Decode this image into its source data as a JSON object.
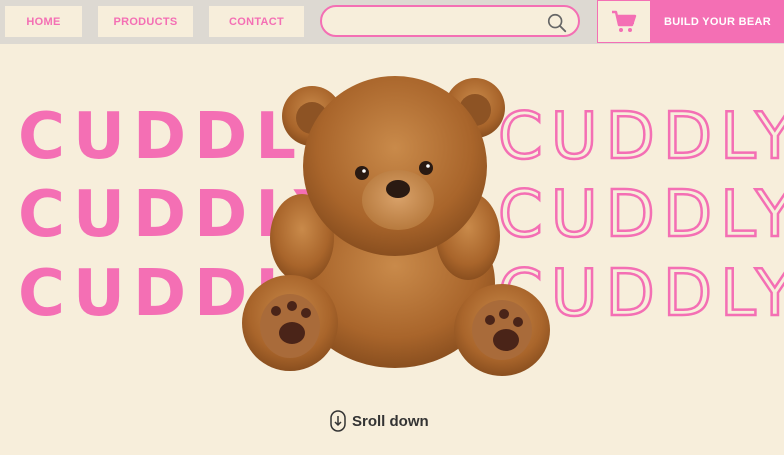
{
  "nav": {
    "home": "HOME",
    "products": "PRODUCTS",
    "contact": "CONTACT"
  },
  "search": {
    "placeholder": "",
    "icon": "search-icon"
  },
  "cart": {
    "icon": "cart-icon"
  },
  "build_button": "BUILD YOUR BEAR",
  "hero": {
    "word": "CUDDLY",
    "rows": 3
  },
  "scroll": {
    "label": "Sroll down",
    "icon": "mouse-scroll-icon"
  },
  "colors": {
    "accent": "#f46fb4",
    "background": "#f7eedb",
    "bar": "#ddd9d2"
  }
}
